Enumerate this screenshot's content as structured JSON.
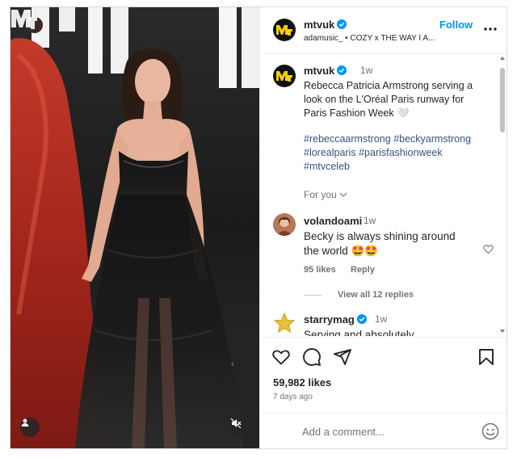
{
  "header": {
    "username": "mtvuk",
    "subtitle": "adamusic_ • COZY x THE WAY I A...",
    "follow_label": "Follow"
  },
  "caption": {
    "username": "mtvuk",
    "time": "1w",
    "text": "Rebecca Patricia Armstrong serving a look on the L'Oréal Paris runway for Paris Fashion Week 🤍",
    "hashtags": "#rebeccaarmstrong #beckyarmstrong #lorealparis #parisfashionweek #mtvceleb",
    "for_you": "For you"
  },
  "comments": [
    {
      "username": "volandoami",
      "time": "1w",
      "text": "Becky is always shining around the world 🤩🤩",
      "likes": "95 likes",
      "reply_label": "Reply",
      "view_replies": "View all 12 replies"
    },
    {
      "username": "starrymag",
      "time": "1w",
      "text": "Serving and absolutely..."
    }
  ],
  "post": {
    "likes": "59,982 likes",
    "ago": "7 days ago"
  },
  "composer": {
    "placeholder": "Add a comment..."
  },
  "icons": {
    "heart": "heart-icon",
    "comment": "comment-icon",
    "share": "share-icon",
    "save": "bookmark-icon",
    "more": "more-horizontal-icon",
    "emoji": "emoji-icon"
  },
  "colors": {
    "accent": "#0095f6",
    "hashtag": "#385185",
    "muted": "#737373",
    "verified": "#0095f6"
  }
}
